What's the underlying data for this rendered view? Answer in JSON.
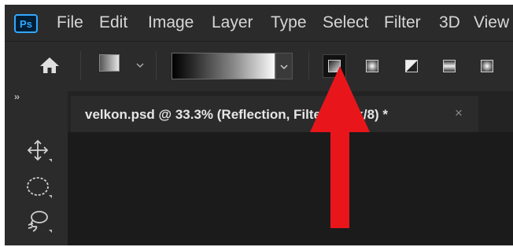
{
  "menubar": {
    "logo": "Ps",
    "items": [
      "File",
      "Edit",
      "Image",
      "Layer",
      "Type",
      "Select",
      "Filter",
      "3D",
      "View"
    ]
  },
  "options_bar": {
    "home_icon": "home-icon",
    "gradient_types": [
      "linear-gradient",
      "radial-gradient",
      "angle-gradient",
      "reflected-gradient",
      "diamond-gradient"
    ],
    "active_gradient_type": "linear-gradient"
  },
  "panels": {
    "collapse": "››"
  },
  "document": {
    "tab_title": "velkon.psd @ 33.3% (Reflection, Filter Mask/8) *",
    "close": "×"
  },
  "tools": [
    "move-tool-icon",
    "elliptical-marquee-tool-icon",
    "lasso-tool-icon"
  ],
  "colors": {
    "ps_blue": "#31a8ff",
    "panel_bg": "#2b2b2c",
    "canvas_bg": "#1b1b1c",
    "annotation_arrow": "#e8161b"
  }
}
